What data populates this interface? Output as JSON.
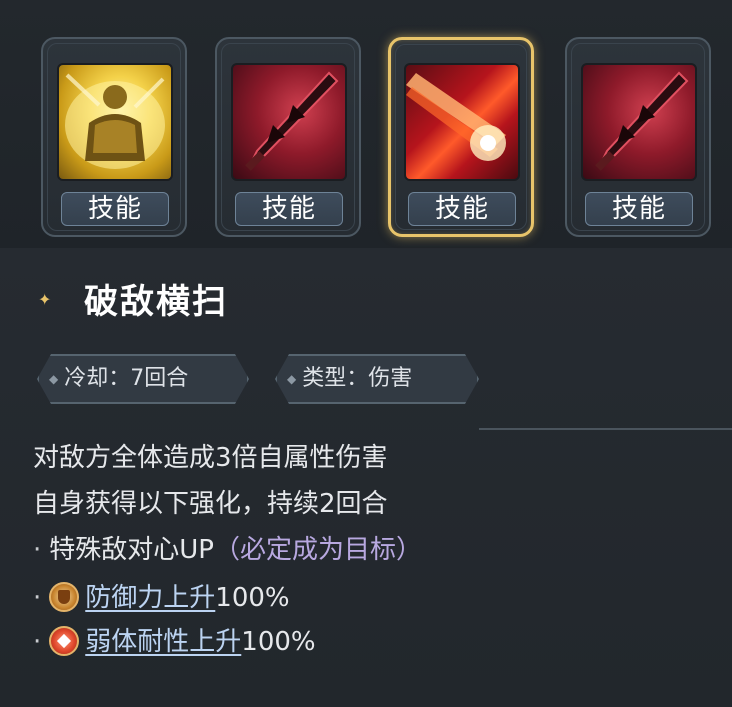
{
  "skills": [
    {
      "label": "技能",
      "icon": "golden-armor-warrior-icon",
      "active": false
    },
    {
      "label": "技能",
      "icon": "crimson-greatsword-icon",
      "active": false
    },
    {
      "label": "技能",
      "icon": "red-slash-beam-icon",
      "active": true
    },
    {
      "label": "技能",
      "icon": "crimson-greatsword-icon",
      "active": false
    }
  ],
  "detail": {
    "title": "破敌横扫",
    "cooldown": "冷却：7回合",
    "type": "类型：伤害",
    "lines": [
      "对敌方全体造成3倍自属性伤害",
      "自身获得以下强化，持续2回合"
    ],
    "bullet_1_main": "特殊敌对心UP",
    "bullet_1_paren": "（必定成为目标）",
    "buff_1_name": "防御力上升",
    "buff_1_value": "100%",
    "buff_2_name": "弱体耐性上升",
    "buff_2_value": "100%",
    "bullet_dot": "·"
  },
  "colors": {
    "active_border": "#e8c46a",
    "link": "#bcd4f2",
    "paren": "#b8a8e0"
  }
}
